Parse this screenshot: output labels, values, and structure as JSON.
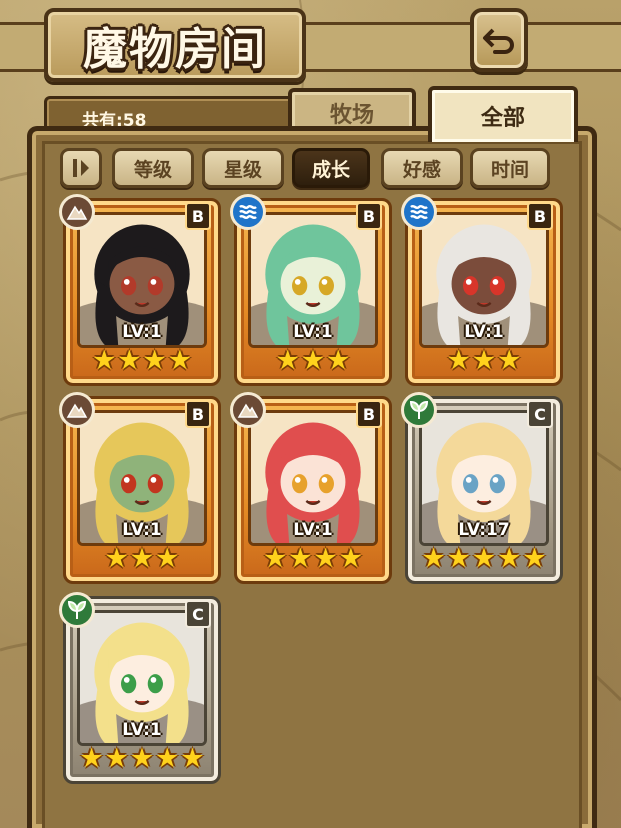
{
  "header": {
    "title": "魔物房间",
    "back_icon": "back-arrow-icon"
  },
  "summary": {
    "count_label": "共有:58"
  },
  "tabs": [
    {
      "label": "牧场",
      "active": false
    },
    {
      "label": "全部",
      "active": true
    }
  ],
  "sort": {
    "toggle_icon": "sort-order-icon",
    "buttons": [
      {
        "label": "等级",
        "active": false
      },
      {
        "label": "星级",
        "active": false
      },
      {
        "label": "成长",
        "active": true
      },
      {
        "label": "好感",
        "active": false
      },
      {
        "label": "时间",
        "active": false
      }
    ]
  },
  "monsters": [
    {
      "rank": "B",
      "element": "earth-icon",
      "level": "LV:1",
      "stars": 4,
      "frame": "gold",
      "hair": "#1d1a1c",
      "skin": "#8a5a44",
      "eyes": "#b23a2a"
    },
    {
      "rank": "B",
      "element": "water-icon",
      "level": "LV:1",
      "stars": 3,
      "frame": "gold",
      "hair": "#6fc59c",
      "skin": "#e9f1d8",
      "eyes": "#d6a826"
    },
    {
      "rank": "B",
      "element": "water-icon",
      "level": "LV:1",
      "stars": 3,
      "frame": "gold",
      "hair": "#e9e6e1",
      "skin": "#7b4c3b",
      "eyes": "#d8352a"
    },
    {
      "rank": "B",
      "element": "earth-icon",
      "level": "LV:1",
      "stars": 3,
      "frame": "gold",
      "hair": "#e6c75a",
      "skin": "#8fb37a",
      "eyes": "#c2351f"
    },
    {
      "rank": "B",
      "element": "earth-icon",
      "level": "LV:1",
      "stars": 4,
      "frame": "gold",
      "hair": "#e04e4e",
      "skin": "#fbe3d6",
      "eyes": "#e7a12c"
    },
    {
      "rank": "C",
      "element": "wood-icon",
      "level": "LV:17",
      "stars": 5,
      "frame": "silver",
      "hair": "#f4d99a",
      "skin": "#fdeee0",
      "eyes": "#6aa3c5"
    },
    {
      "rank": "C",
      "element": "wood-icon",
      "level": "LV:1",
      "stars": 5,
      "frame": "silver",
      "hair": "#f3e08b",
      "skin": "#fdeee0",
      "eyes": "#3c9e49"
    }
  ]
}
